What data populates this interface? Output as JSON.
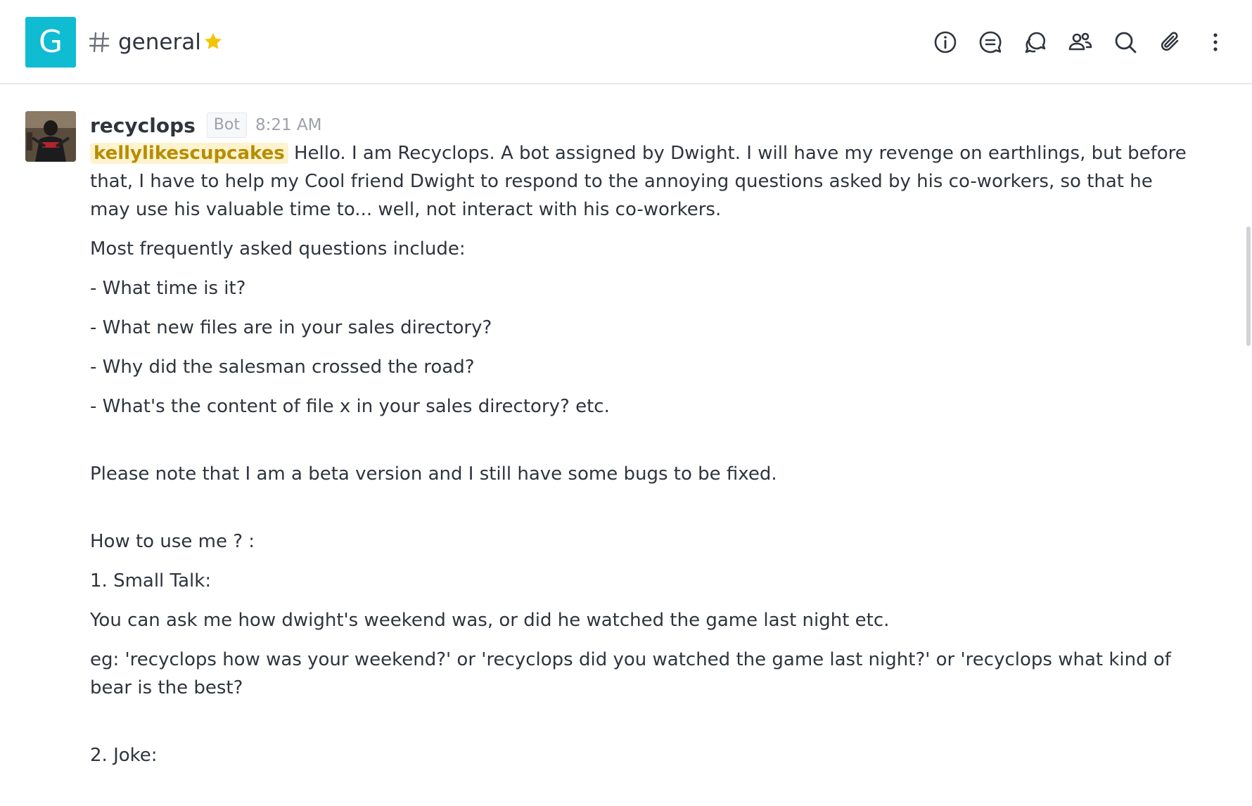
{
  "header": {
    "room_avatar_letter": "G",
    "room_name": "general",
    "accent_color": "#0fbcd1",
    "favorite_color": "#f5c400",
    "toolbar": [
      {
        "name": "room-info-icon",
        "label": "Room info"
      },
      {
        "name": "discussion-icon",
        "label": "Discussion"
      },
      {
        "name": "threads-icon",
        "label": "Threads"
      },
      {
        "name": "members-icon",
        "label": "Members"
      },
      {
        "name": "search-icon",
        "label": "Search"
      },
      {
        "name": "files-icon",
        "label": "Files"
      },
      {
        "name": "kebab-menu-icon",
        "label": "More"
      }
    ]
  },
  "message": {
    "username": "recyclops",
    "badge": "Bot",
    "time": "8:21 AM",
    "mention": "kellylikescupcakes",
    "intro": " Hello. I am Recyclops. A bot assigned by Dwight. I will have my revenge on earthlings, but before that, I have to help my Cool friend Dwight to respond to the annoying questions asked by his co-workers, so that he may use his valuable time to... well, not interact with his co-workers.",
    "faq_title": "Most frequently asked questions include:",
    "faq": [
      "- What time is it?",
      "- What new files are in your sales directory?",
      "- Why did the salesman crossed the road?",
      "- What's the content of file x in your sales directory? etc."
    ],
    "beta_note": "Please note that I am a beta version and I still have some bugs to be fixed.",
    "usage_title": "How to use me ? :",
    "small_talk_title": "1. Small Talk:",
    "small_talk_desc": "You can ask me how dwight's weekend was, or did he watched the game last night etc.",
    "small_talk_example": "eg: 'recyclops how was your weekend?' or 'recyclops did you watched the game last night?' or 'recyclops what kind of bear is the best?",
    "joke_title": "2. Joke:"
  }
}
